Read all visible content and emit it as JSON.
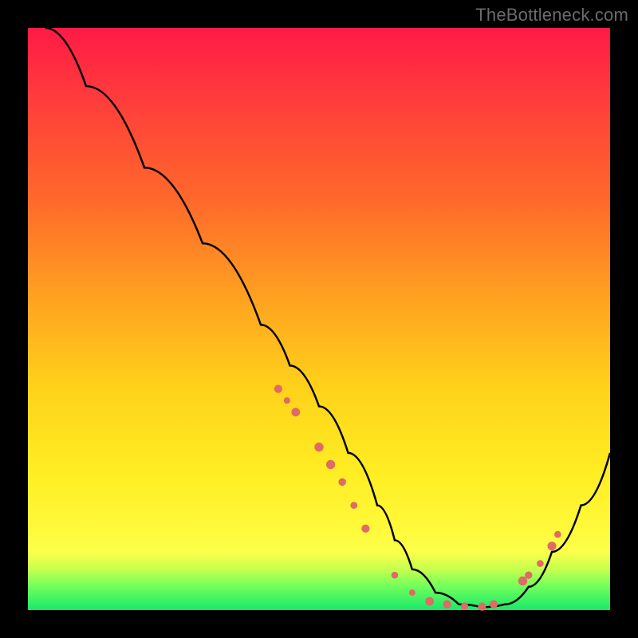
{
  "watermark": "TheBottleneck.com",
  "chart_data": {
    "type": "line",
    "title": "",
    "xlabel": "",
    "ylabel": "",
    "xlim": [
      0,
      100
    ],
    "ylim": [
      0,
      100
    ],
    "x": [
      3,
      10,
      20,
      30,
      40,
      45,
      50,
      55,
      60,
      63,
      66,
      70,
      74,
      78,
      82,
      86,
      90,
      95,
      100
    ],
    "y": [
      100,
      90,
      76,
      63,
      49,
      42,
      35,
      27,
      18,
      12,
      7,
      3,
      1,
      0.5,
      1,
      4,
      10,
      18,
      27
    ],
    "markers": {
      "x": [
        43,
        44.5,
        46,
        50,
        52,
        54,
        56,
        58,
        63,
        66,
        69,
        72,
        75,
        78,
        80,
        85,
        86,
        88,
        90,
        91
      ],
      "y": [
        38,
        36,
        34,
        28,
        25,
        22,
        18,
        14,
        6,
        3,
        1.5,
        1,
        0.7,
        0.6,
        1,
        5,
        6,
        8,
        11,
        13
      ]
    },
    "colors": {
      "curve": "#000000",
      "markers": "#e06a64",
      "gradient_top": "#ff1a46",
      "gradient_mid": "#ffd21a",
      "gradient_bottom": "#17e86b"
    }
  }
}
